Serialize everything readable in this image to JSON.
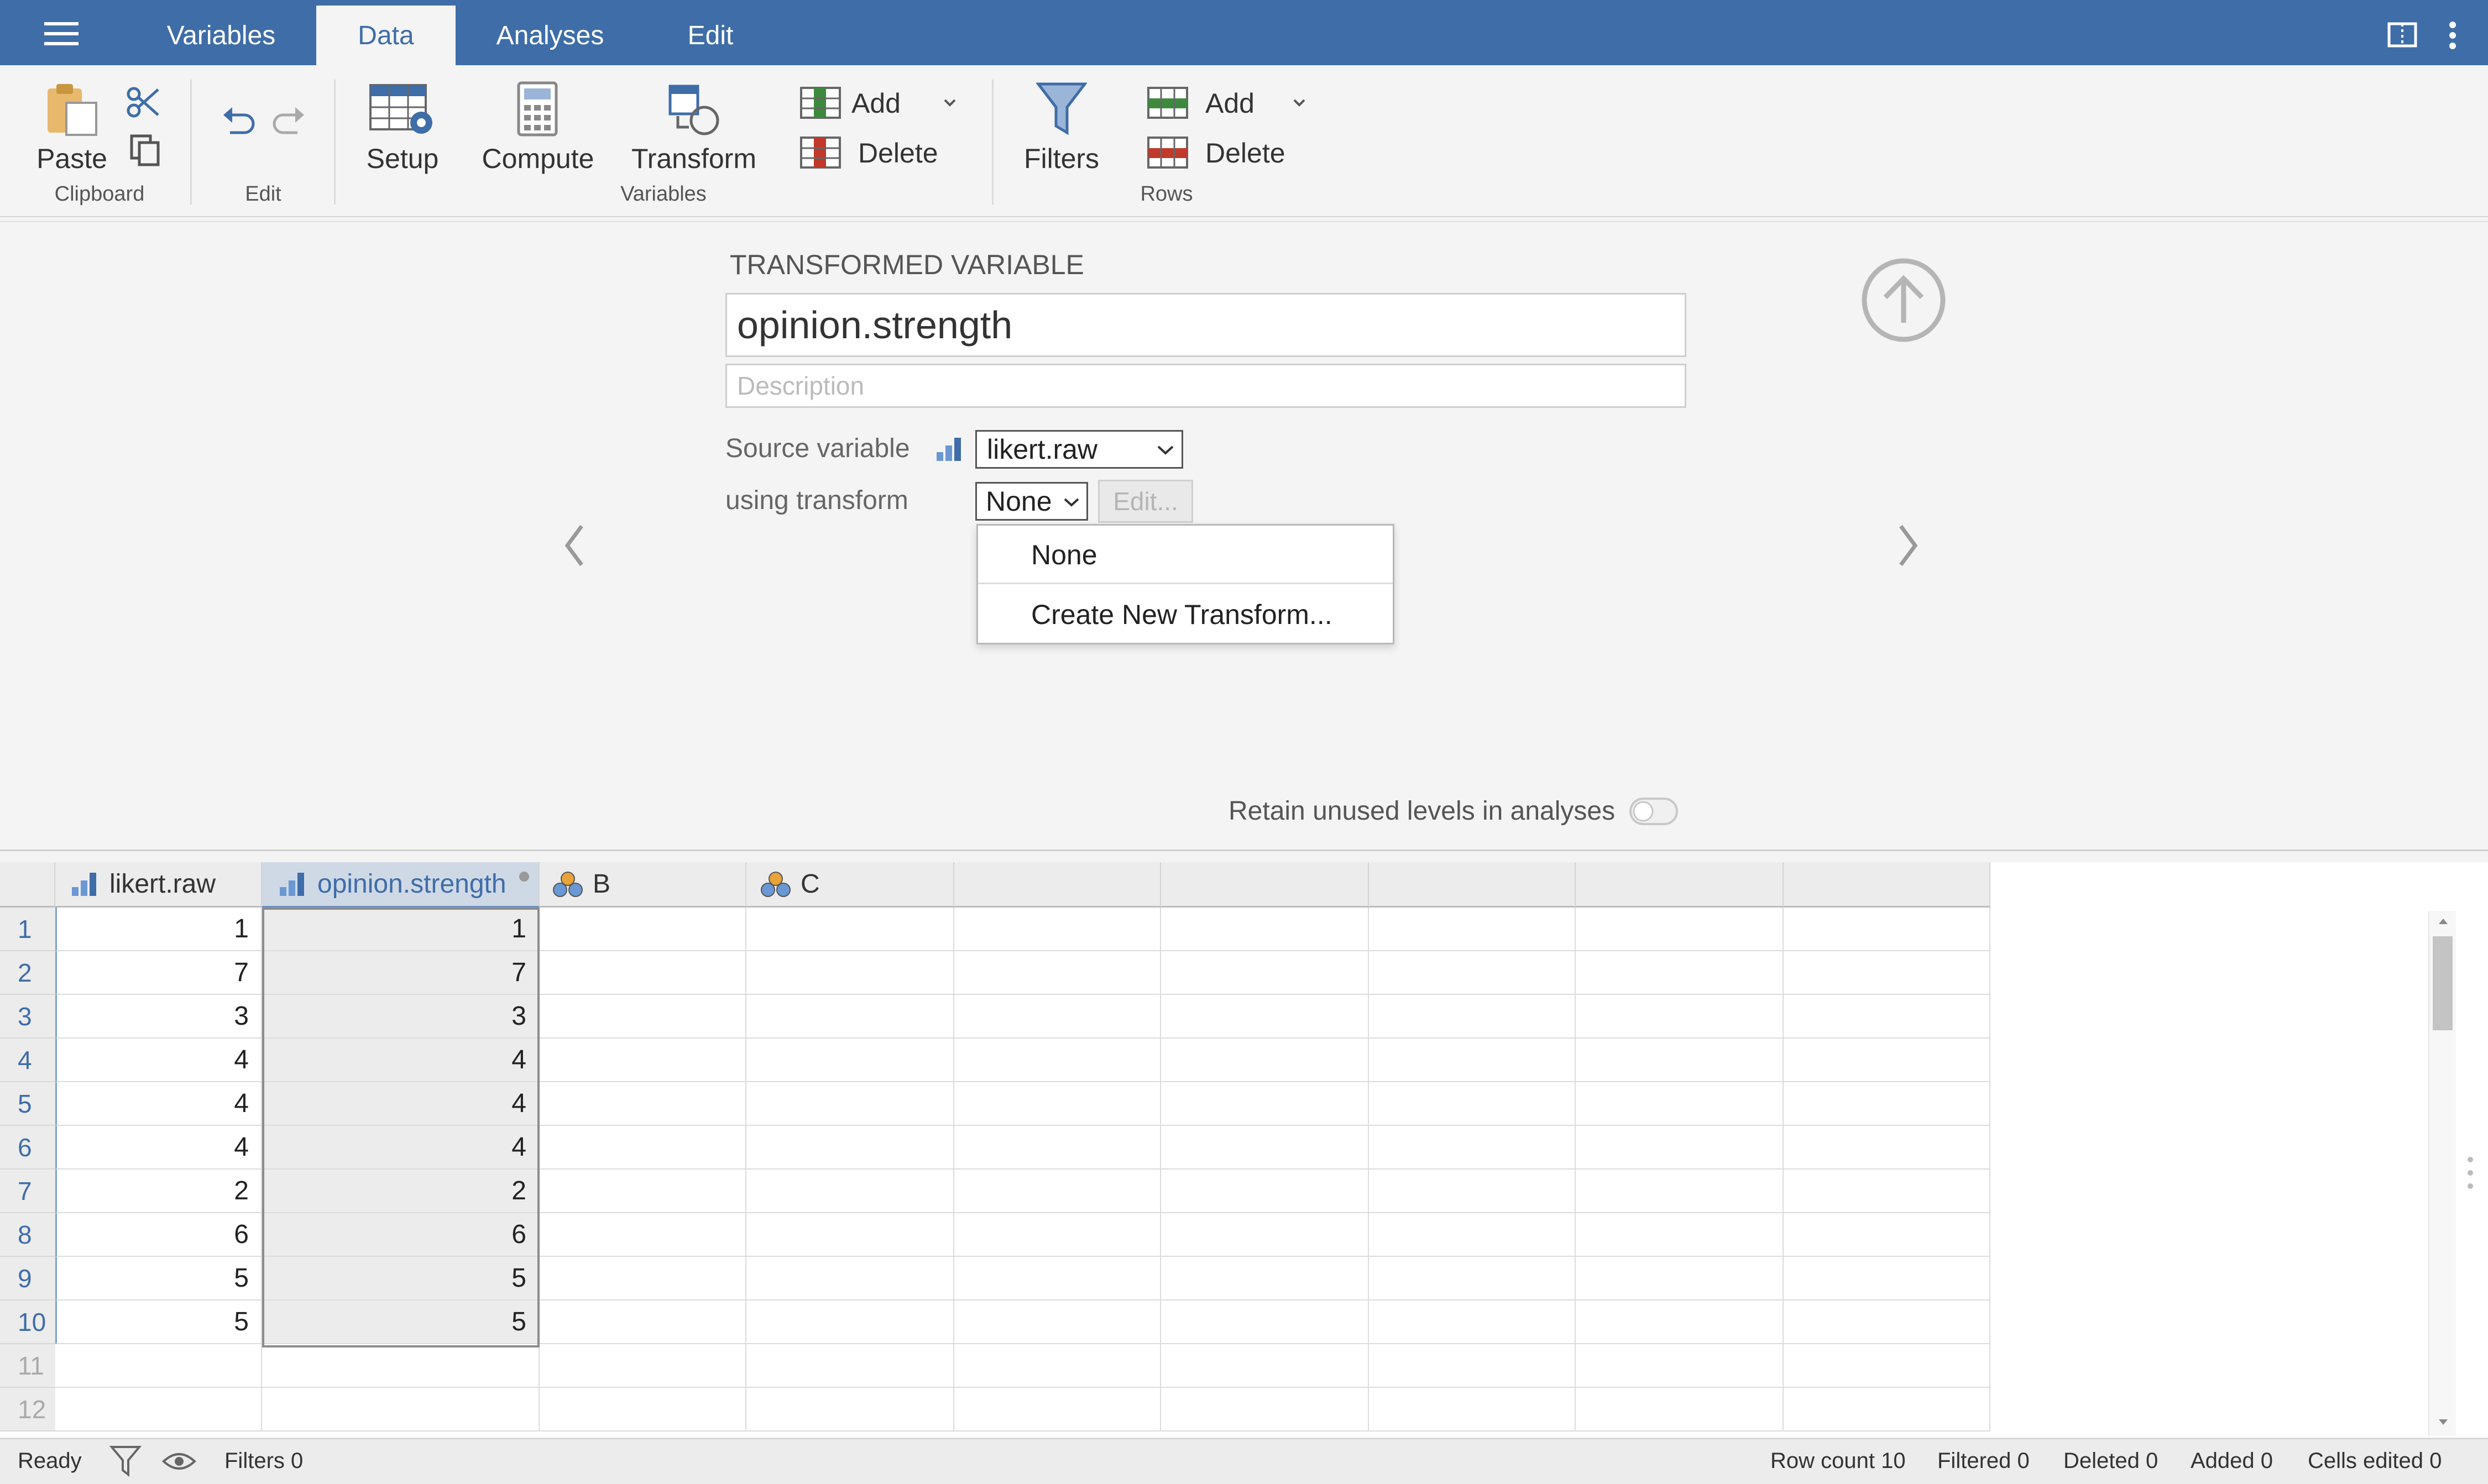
{
  "tabs": [
    "Variables",
    "Data",
    "Analyses",
    "Edit"
  ],
  "ribbon": {
    "clipboard": {
      "paste": "Paste",
      "group": "Clipboard"
    },
    "edit": {
      "group": "Edit"
    },
    "variables": {
      "setup": "Setup",
      "compute": "Compute",
      "transform": "Transform",
      "add": "Add",
      "delete": "Delete",
      "group": "Variables"
    },
    "rows": {
      "filters": "Filters",
      "add": "Add",
      "delete": "Delete",
      "group": "Rows"
    }
  },
  "editor": {
    "header": "TRANSFORMED VARIABLE",
    "name_value": "opinion.strength",
    "description_placeholder": "Description",
    "source_label": "Source variable",
    "source_value": "likert.raw",
    "transform_label": "using transform",
    "transform_value": "None",
    "edit_button": "Edit...",
    "dropdown_options": [
      "None",
      "Create New Transform..."
    ],
    "retain_label": "Retain unused levels in analyses",
    "retain_on": false
  },
  "grid": {
    "columns": [
      "likert.raw",
      "opinion.strength",
      "B",
      "C"
    ],
    "row_numbers": [
      "1",
      "2",
      "3",
      "4",
      "5",
      "6",
      "7",
      "8",
      "9",
      "10",
      "11",
      "12"
    ],
    "likert_raw": [
      "1",
      "7",
      "3",
      "4",
      "4",
      "4",
      "2",
      "6",
      "5",
      "5"
    ],
    "opinion_strength": [
      "1",
      "7",
      "3",
      "4",
      "4",
      "4",
      "2",
      "6",
      "5",
      "5"
    ]
  },
  "status": {
    "ready": "Ready",
    "filters": "Filters 0",
    "row_count": "Row count 10",
    "filtered": "Filtered 0",
    "deleted": "Deleted 0",
    "added": "Added 0",
    "cells_edited": "Cells edited 0"
  },
  "colors": {
    "accent": "#3e6da8",
    "add_green": "#3d8a3d",
    "delete_red": "#c0392b"
  }
}
